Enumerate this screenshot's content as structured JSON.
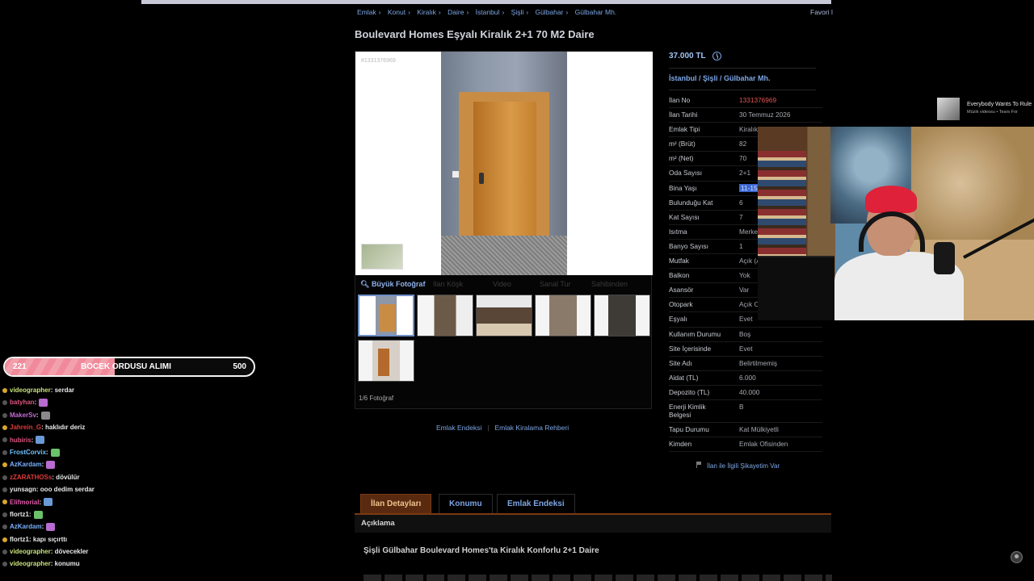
{
  "breadcrumb": [
    "Emlak",
    "Konut",
    "Kiralık",
    "Daire",
    "İstanbul",
    "Şişli",
    "Gülbahar",
    "Gülbahar Mh."
  ],
  "favori": "Favori l",
  "listing": {
    "title": "Boulevard Homes Eşyalı Kiralık 2+1 70 M2 Daire",
    "photo_id": "#1331376969",
    "price": "37.000 TL",
    "location": "İstanbul / Şişli / Gülbahar Mh.",
    "photo_count": "1/6 Fotoğraf"
  },
  "photo_toolbar": [
    "Büyük Fotoğraf",
    "Ilan Köşk",
    "Video",
    "Sanal Tur",
    "Sahibinden"
  ],
  "details": [
    {
      "key": "İlan No",
      "value": "1331376969"
    },
    {
      "key": "İlan Tarihi",
      "value": "30 Temmuz 2026"
    },
    {
      "key": "Emlak Tipi",
      "value": "Kiralık Daire"
    },
    {
      "key": "m² (Brüt)",
      "value": "82"
    },
    {
      "key": "m² (Net)",
      "value": "70"
    },
    {
      "key": "Oda Sayısı",
      "value": "2+1"
    },
    {
      "key": "Bina Yaşı",
      "value": "11-15"
    },
    {
      "key": "Bulunduğu Kat",
      "value": "6"
    },
    {
      "key": "Kat Sayısı",
      "value": "7"
    },
    {
      "key": "Isıtma",
      "value": "Merkezi"
    },
    {
      "key": "Banyo Sayısı",
      "value": "1"
    },
    {
      "key": "Mutfak",
      "value": "Açık (Amerikan)"
    },
    {
      "key": "Balkon",
      "value": "Yok"
    },
    {
      "key": "Asansör",
      "value": "Var"
    },
    {
      "key": "Otopark",
      "value": "Açık Otopark"
    },
    {
      "key": "Eşyalı",
      "value": "Evet"
    },
    {
      "key": "Kullanım Durumu",
      "value": "Boş"
    },
    {
      "key": "Site İçerisinde",
      "value": "Evet"
    },
    {
      "key": "Site Adı",
      "value": "Belirtilmemiş"
    },
    {
      "key": "Aidat (TL)",
      "value": "6.000"
    },
    {
      "key": "Depozito (TL)",
      "value": "40.000"
    },
    {
      "key": "Enerji Kimlik Belgesi",
      "value": "B"
    },
    {
      "key": "Tapu Durumu",
      "value": "Kat Mülkiyetli"
    },
    {
      "key": "Kimden",
      "value": "Emlak Ofisinden"
    }
  ],
  "report_link": "İlan ile İlgili Şikayetim Var",
  "links": [
    "Emlak Endeksi",
    "Emlak Kiralama Rehberi"
  ],
  "tabs": [
    "İlan Detayları",
    "Konumu",
    "Emlak Endeksi"
  ],
  "description": {
    "heading": "Açıklama",
    "title": "Şişli Gülbahar Boulevard Homes'ta Kiralık Konforlu 2+1 Daire"
  },
  "music": {
    "title": "Everybody Wants To Rule",
    "subtitle": "Müzik videosu • Tears For"
  },
  "goal": {
    "current": "221",
    "title": "BOCEK ORDUSU ALIMI",
    "target": "500",
    "progress": 0.442
  },
  "chat": [
    {
      "user": "videographer",
      "text": ": serdar",
      "color": "#c8e27a"
    },
    {
      "user": "batyhan",
      "text": ":",
      "color": "#e05580"
    },
    {
      "user": "MakerSv",
      "text": ":",
      "color": "#c56cd6"
    },
    {
      "user": "Jahrein_G",
      "text": ": haklıdır deriz",
      "color": "#e23b3b"
    },
    {
      "user": "hubiris",
      "text": ":",
      "color": "#e05580"
    },
    {
      "user": "FrostCorvix",
      "text": ":",
      "color": "#6fc3ff"
    },
    {
      "user": "AzKardam",
      "text": ":",
      "color": "#7ab0ff"
    },
    {
      "user": "zZARATHOSs",
      "text": ": dövülür",
      "color": "#e23b3b"
    },
    {
      "user": "yunsagn",
      "text": ": ooo dedim serdar",
      "color": "#e8e8e8"
    },
    {
      "user": "Elifmorial",
      "text": ":",
      "color": "#e05aa8"
    },
    {
      "user": "flortz1",
      "text": ":",
      "color": "#e8e8e8"
    },
    {
      "user": "AzKardam",
      "text": ":",
      "color": "#7ab0ff"
    },
    {
      "user": "flortz1",
      "text": ": kapı sıçırttı",
      "color": "#e8e8e8"
    },
    {
      "user": "videographer",
      "text": ": dövecekler",
      "color": "#c8e27a"
    },
    {
      "user": "videographer",
      "text": ": konumu",
      "color": "#c8e27a"
    }
  ]
}
